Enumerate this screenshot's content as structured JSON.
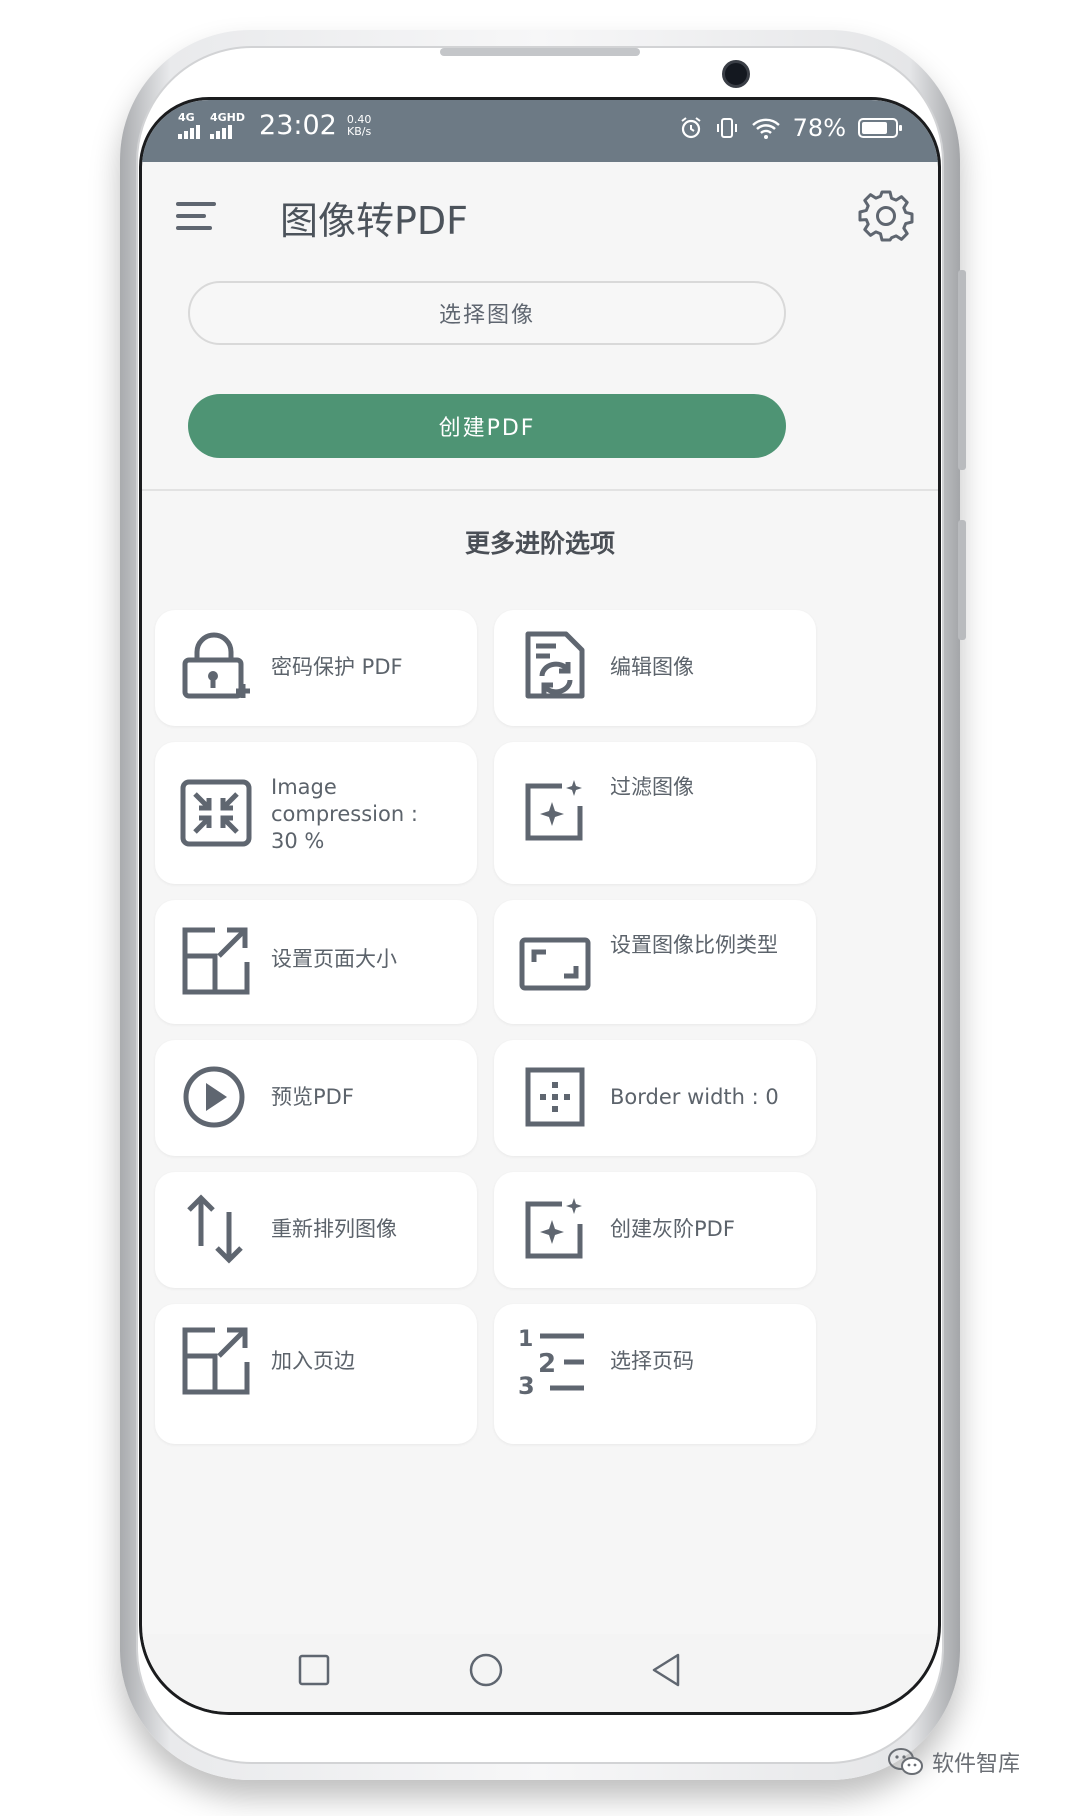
{
  "status_bar": {
    "network1": "4G",
    "network2": "4GHD",
    "time": "23:02",
    "speed_value": "0.40",
    "speed_unit": "KB/s",
    "battery": "78%",
    "battery_level": 0.78
  },
  "app": {
    "title": "图像转PDF"
  },
  "actions": {
    "select_images": "选择图像",
    "create_pdf": "创建PDF"
  },
  "section": {
    "title": "更多进阶选项"
  },
  "options": [
    {
      "label": "密码保护 PDF",
      "icon": "lock-add-icon"
    },
    {
      "label": "编辑图像",
      "icon": "edit-image-icon"
    },
    {
      "label": "Image compression : 30 %",
      "icon": "compress-icon"
    },
    {
      "label": "过滤图像",
      "icon": "filter-sparkle-icon"
    },
    {
      "label": "设置页面大小",
      "icon": "page-size-icon"
    },
    {
      "label": "设置图像比例类型",
      "icon": "aspect-ratio-icon"
    },
    {
      "label": "预览PDF",
      "icon": "play-icon"
    },
    {
      "label": "Border width : 0",
      "icon": "border-icon"
    },
    {
      "label": "重新排列图像",
      "icon": "reorder-icon"
    },
    {
      "label": "创建灰阶PDF",
      "icon": "grayscale-sparkle-icon"
    },
    {
      "label": "加入页边",
      "icon": "margin-icon"
    },
    {
      "label": "选择页码",
      "icon": "page-numbers-icon"
    }
  ],
  "watermark": "软件智库",
  "colors": {
    "accent": "#4e9474",
    "status_bar": "#6d7a85",
    "icon": "#5f6670"
  }
}
